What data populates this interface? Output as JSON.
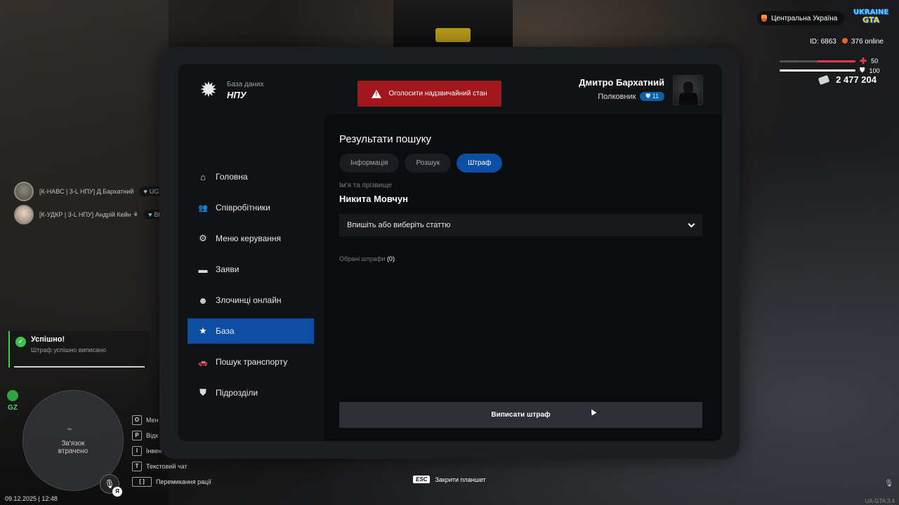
{
  "hud": {
    "region": "Центральна Україна",
    "logo_top": "UKRAINE",
    "logo_bottom": "GTA",
    "id_text": "ID: 6863",
    "online_text": "376 online",
    "health_value": "50",
    "armor_value": "100",
    "health_level": 0.5,
    "armor_level": 1.0,
    "money": "2 477 204",
    "colors": {
      "health": "#e53a4a",
      "armor": "#ffffff"
    }
  },
  "players": [
    {
      "name": "[К-НАВС | 3-L НПУ] Д.Бархатний",
      "tag": "UGTA"
    },
    {
      "name": "[К-УДКР | 3-L НПУ] Андрій Кейн ⚘",
      "tag": "BMW"
    }
  ],
  "notification": {
    "title": "Успішно!",
    "text": "Штраф успішно виписано"
  },
  "minimap": {
    "zone": "GZ",
    "status": "Зв'язок\nвтрачено",
    "mic_badge": "Я"
  },
  "datetime": "09.12.2025 | 12:48",
  "hotkeys": [
    {
      "key": "O",
      "label": "Мен"
    },
    {
      "key": "P",
      "label": "Відк"
    },
    {
      "key": "I",
      "label": "Інвент"
    },
    {
      "key": "T",
      "label": "Текстовий чат"
    },
    {
      "key": "[ ]",
      "label": "Перемикання рації"
    }
  ],
  "bottom": {
    "esc_key": "ESC",
    "esc_label": "Закрити планшет",
    "version": "UA-GTA 3.4"
  },
  "tablet": {
    "brand_small": "База даних",
    "brand_big": "НПУ",
    "alert_button": "Оголосити надзвичайний стан",
    "user": {
      "name": "Дмитро Бархатний",
      "rank": "Полковник",
      "level": "11"
    },
    "menu": [
      {
        "label": "Головна",
        "icon": "home-icon",
        "glyph": "⌂"
      },
      {
        "label": "Співробітники",
        "icon": "users-icon",
        "glyph": "👥"
      },
      {
        "label": "Меню керування",
        "icon": "gear-icon",
        "glyph": "⚙"
      },
      {
        "label": "Заяви",
        "icon": "folder-icon",
        "glyph": "▬"
      },
      {
        "label": "Злочинці онлайн",
        "icon": "mask-icon",
        "glyph": "☻"
      },
      {
        "label": "База",
        "icon": "star-icon",
        "glyph": "★",
        "active": true
      },
      {
        "label": "Пошук транспорту",
        "icon": "car-icon",
        "glyph": "🚗"
      },
      {
        "label": "Підрозділи",
        "icon": "shield-icon",
        "glyph": "⛊"
      }
    ],
    "content": {
      "title": "Результати пошуку",
      "tabs": [
        "Інформація",
        "Розшук",
        "Штраф"
      ],
      "active_tab": "Штраф",
      "field_label": "Ім'я та прізвище",
      "person_name": "Никита Мовчун",
      "select_placeholder": "Впишіть або виберіть статтю",
      "selected_label": "Обрані штрафи",
      "selected_count": "(0)",
      "submit_label": "Виписати штраф"
    }
  }
}
